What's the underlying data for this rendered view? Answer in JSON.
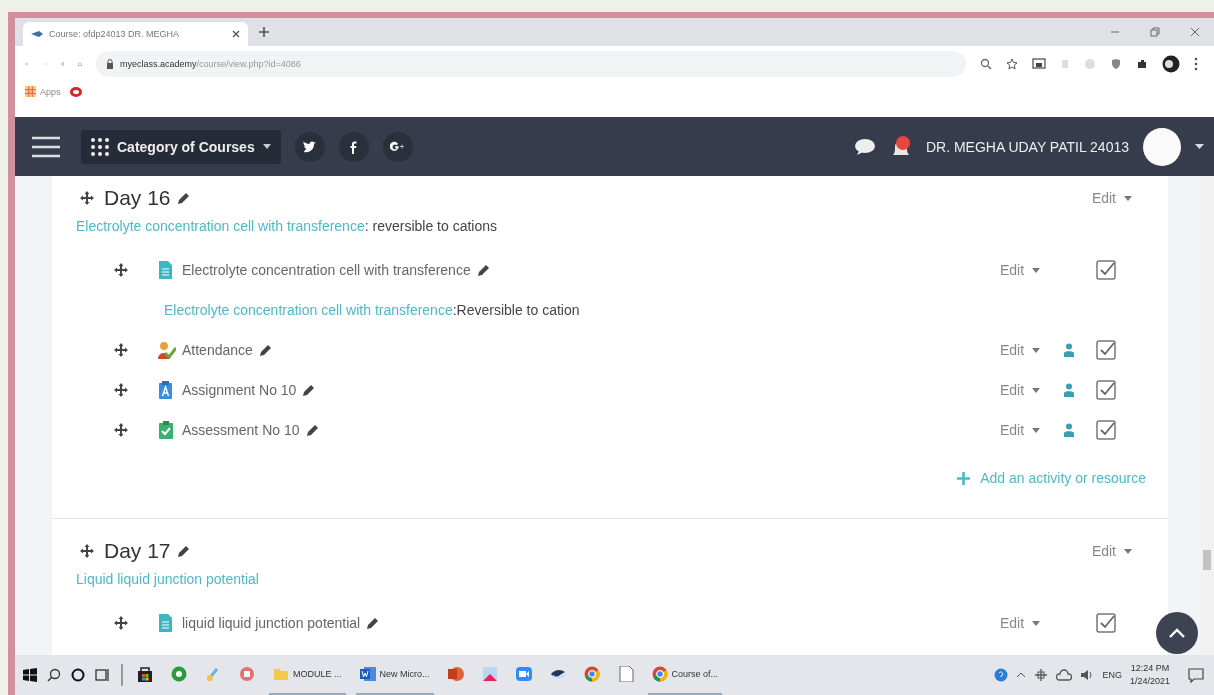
{
  "browser": {
    "tab_title": "Course: ofdp24013 DR. MEGHA",
    "url_host": "myeclass.academy",
    "url_path": "/course/view.php?id=4086",
    "bookmarks": [
      "Apps"
    ]
  },
  "navbar": {
    "menu_label": "Category of Courses",
    "socials": [
      {
        "kind": "twitter"
      },
      {
        "kind": "facebook"
      },
      {
        "kind": "google-plus"
      }
    ],
    "notifications": true,
    "user_name": "DR. MEGHA UDAY PATIL 24013"
  },
  "sections": [
    {
      "title": "Day 16",
      "summary_link": "Electrolyte concentration cell with transference",
      "summary_text": ": reversible to cations",
      "edit": "Edit",
      "add_label": "Add an activity or resource",
      "activities": [
        {
          "kind": "page",
          "name": "Electrolyte concentration cell with transference",
          "edit": "Edit",
          "groups": false,
          "completed": true,
          "description_link": "Electrolyte concentration cell with transference",
          "description_text": ":Reversible to cation"
        },
        {
          "kind": "attendance",
          "name": "Attendance",
          "edit": "Edit",
          "groups": true,
          "completed": true
        },
        {
          "kind": "assignment",
          "name": "Assignment No 10",
          "edit": "Edit",
          "groups": true,
          "completed": true
        },
        {
          "kind": "quiz",
          "name": "Assessment No 10",
          "edit": "Edit",
          "groups": true,
          "completed": true
        }
      ]
    },
    {
      "title": "Day 17",
      "summary_link": "Liquid liquid junction potential",
      "edit": "Edit",
      "activities": [
        {
          "kind": "page",
          "name": "liquid liquid junction potential",
          "edit": "Edit",
          "groups": false,
          "completed": true
        }
      ]
    }
  ],
  "taskbar": {
    "apps": [
      {
        "kind": "store"
      },
      {
        "kind": "green"
      },
      {
        "kind": "paint"
      },
      {
        "kind": "red"
      },
      {
        "kind": "folder",
        "label": "MODULE ..."
      },
      {
        "kind": "word",
        "label": "New Micro..."
      },
      {
        "kind": "powerpoint"
      },
      {
        "kind": "photos"
      },
      {
        "kind": "zoom"
      },
      {
        "kind": "bird"
      },
      {
        "kind": "chrome"
      },
      {
        "kind": "file"
      },
      {
        "kind": "chrome",
        "label": "Course of..."
      }
    ],
    "language": "ENG",
    "time": "12:24 PM",
    "date": "1/24/2021"
  }
}
